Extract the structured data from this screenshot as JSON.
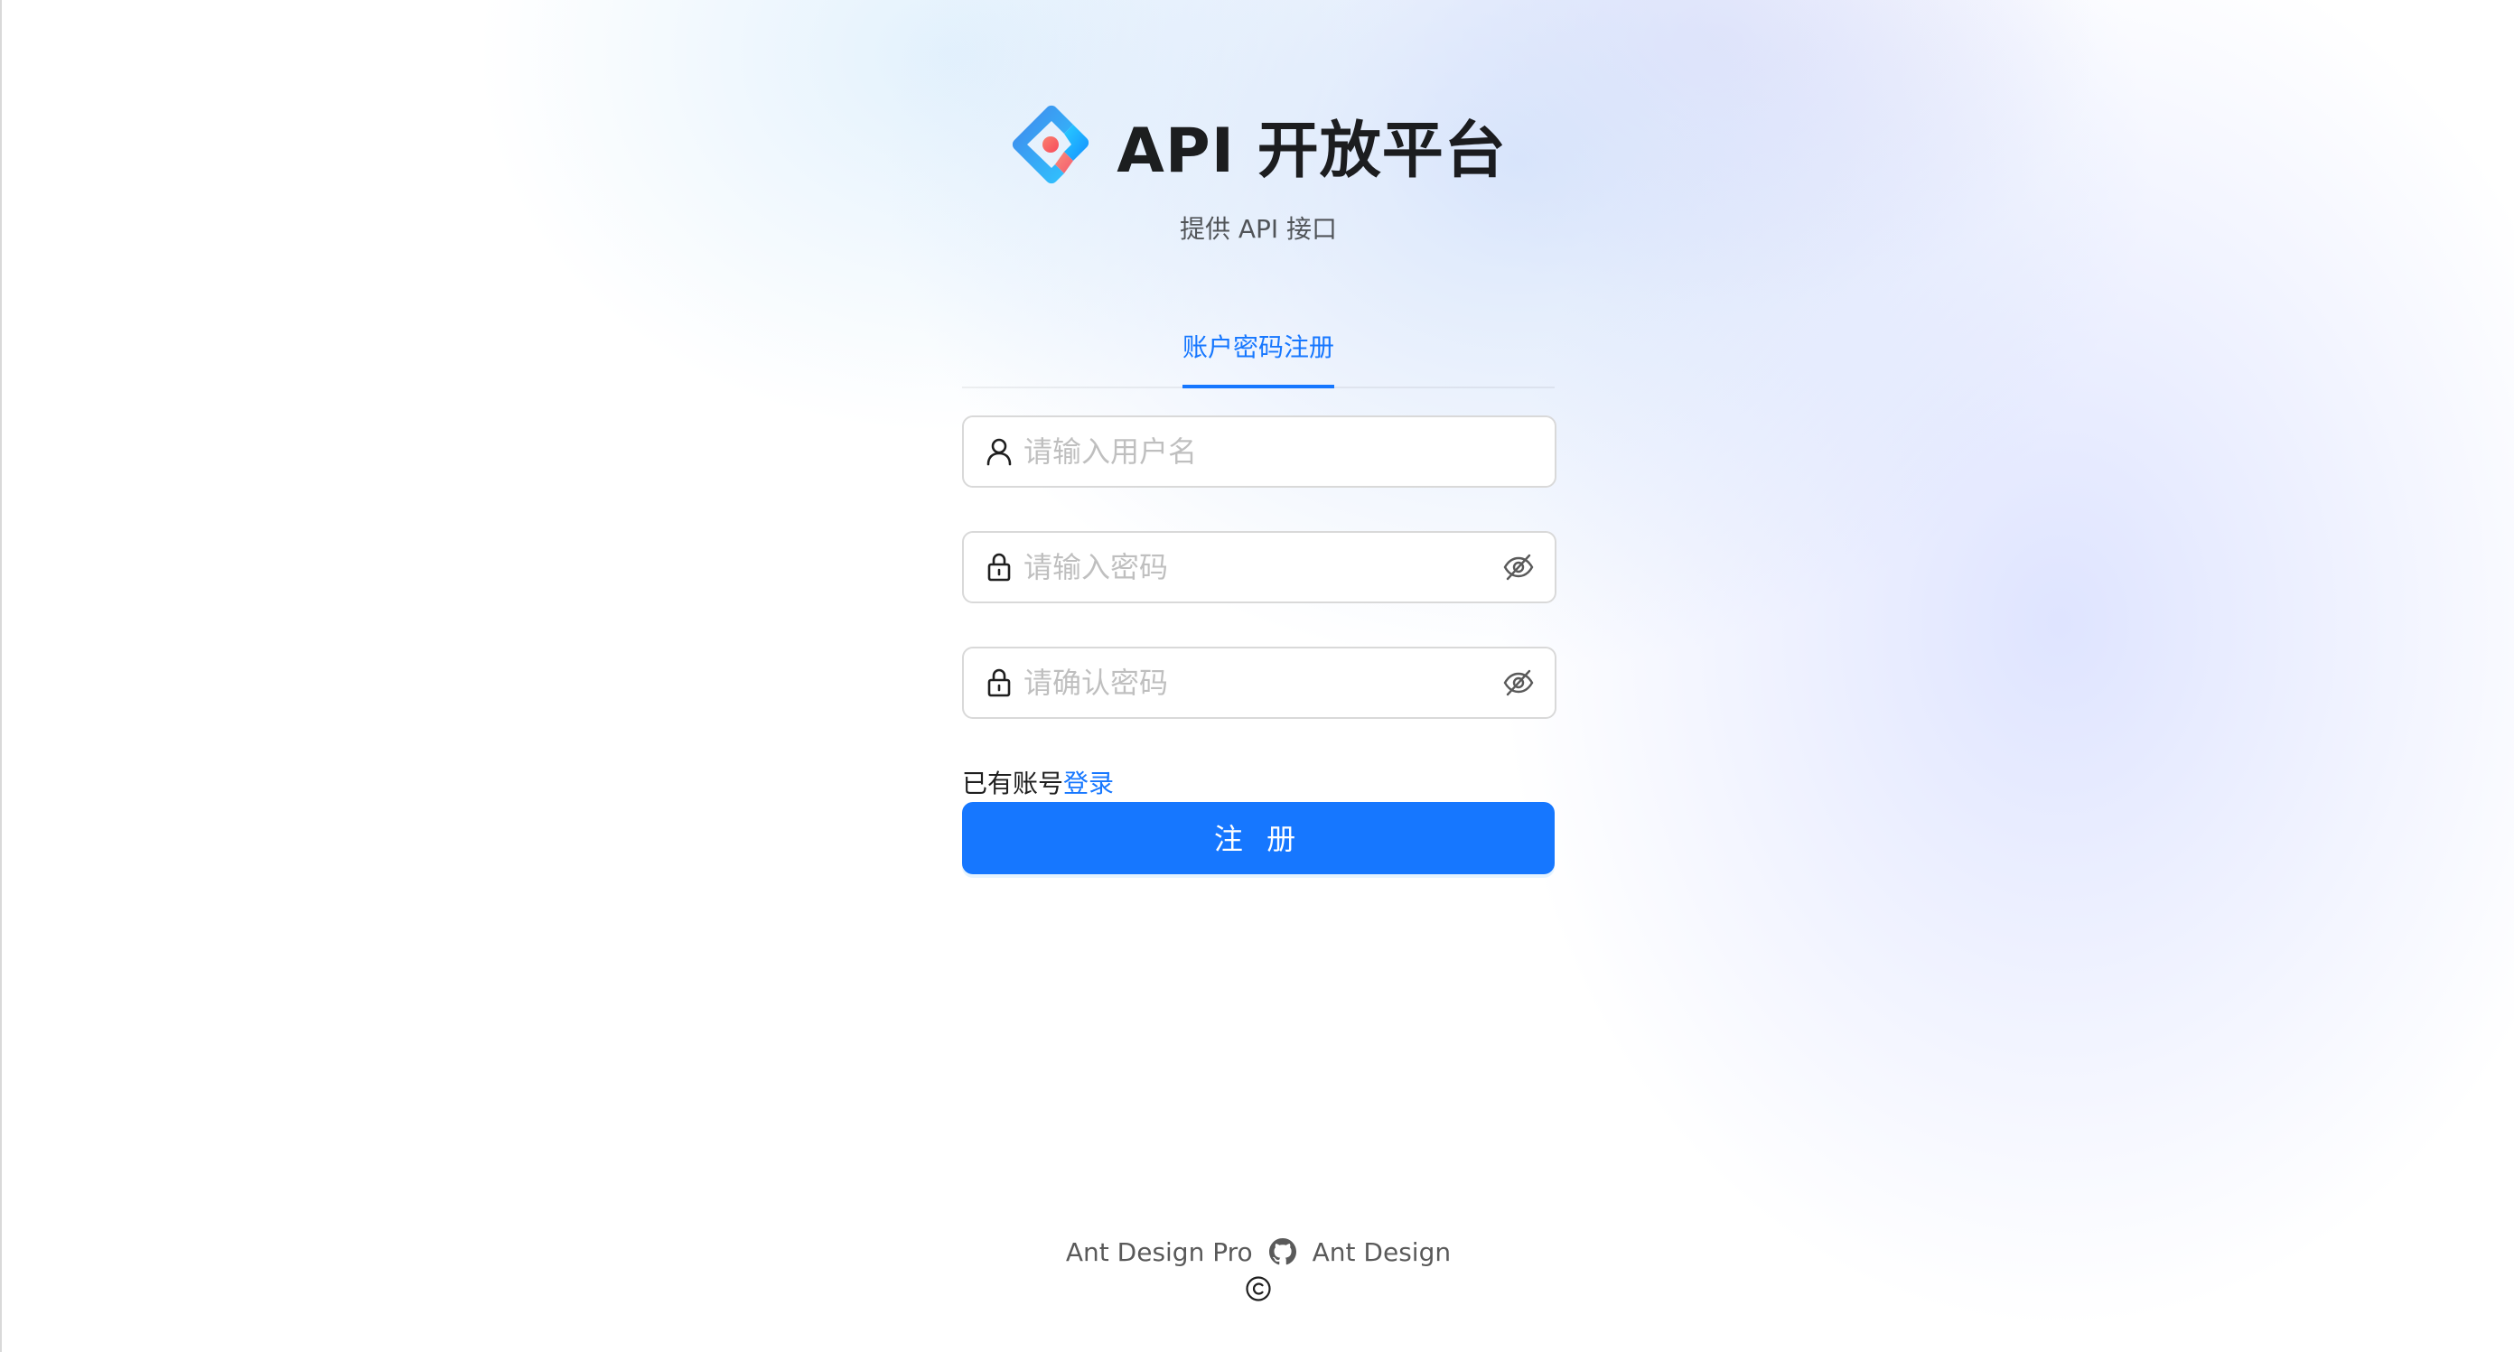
{
  "app": {
    "title": "API 开放平台",
    "subtitle": "提供 API 接口"
  },
  "tabs": [
    {
      "label": "账户密码注册",
      "active": true
    }
  ],
  "form": {
    "username": {
      "placeholder": "请输入用户名",
      "value": "",
      "icon": "user-icon"
    },
    "password": {
      "placeholder": "请输入密码",
      "value": "",
      "icon": "lock-icon",
      "toggle_icon": "eye-invisible-icon"
    },
    "confirm_password": {
      "placeholder": "请确认密码",
      "value": "",
      "icon": "lock-icon",
      "toggle_icon": "eye-invisible-icon"
    },
    "has_account_text": "已有账号",
    "login_link": "登录",
    "submit_label": "注 册"
  },
  "footer": {
    "links": [
      "Ant Design Pro",
      "Ant Design"
    ],
    "github_icon": "github-icon",
    "copyright_icon": "copyright-icon"
  },
  "colors": {
    "primary": "#1677ff",
    "logo_blue": "#1890ff",
    "logo_red": "#f5222d"
  }
}
